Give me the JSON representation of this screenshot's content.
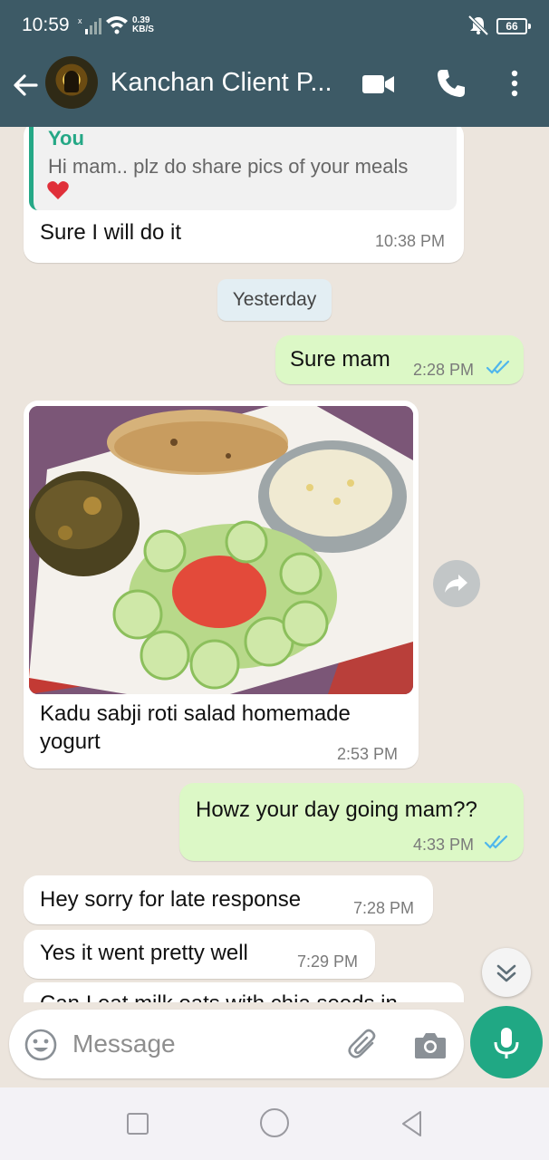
{
  "status_bar": {
    "time": "10:59",
    "network_speed_value": "0.39",
    "network_speed_unit": "KB/S",
    "battery": "66"
  },
  "header": {
    "title": "Kanchan Client P...",
    "icons": [
      "back-arrow-icon",
      "video-call-icon",
      "voice-call-icon",
      "more-vert-icon"
    ],
    "color": "#3d5a66"
  },
  "messages": [
    {
      "direction": "incoming",
      "quote_author": "You",
      "quote_text": "Hi mam.. plz do share pics of your meals",
      "quote_emoji": "red-heart",
      "text": "Sure I will do it",
      "time": "10:38 PM"
    },
    {
      "type": "date",
      "label": "Yesterday"
    },
    {
      "direction": "outgoing",
      "text": "Sure mam",
      "time": "2:28 PM",
      "status": "read"
    },
    {
      "direction": "incoming",
      "type": "image",
      "image_alt": "plate of pumpkin sabji, roti, cucumber tomato salad and bowl of yogurt",
      "caption_line1": "Kadu sabji roti salad homemade",
      "caption_line2": "yogurt",
      "time": "2:53 PM"
    },
    {
      "direction": "outgoing",
      "text": "Howz your day going mam??",
      "time": "4:33 PM",
      "status": "read"
    },
    {
      "direction": "incoming",
      "text": "Hey sorry for late response",
      "time": "7:28 PM"
    },
    {
      "direction": "incoming",
      "text": "Yes it went pretty well",
      "time": "7:29 PM"
    },
    {
      "direction": "incoming",
      "text": "Can I eat milk oats with chia seeds in",
      "partial": true
    }
  ],
  "composer": {
    "placeholder": "Message"
  },
  "colors": {
    "outgoing_bubble": "#dcf8c6",
    "incoming_bubble": "#ffffff",
    "accent": "#20a884",
    "read_ticks": "#4fb6ec"
  }
}
